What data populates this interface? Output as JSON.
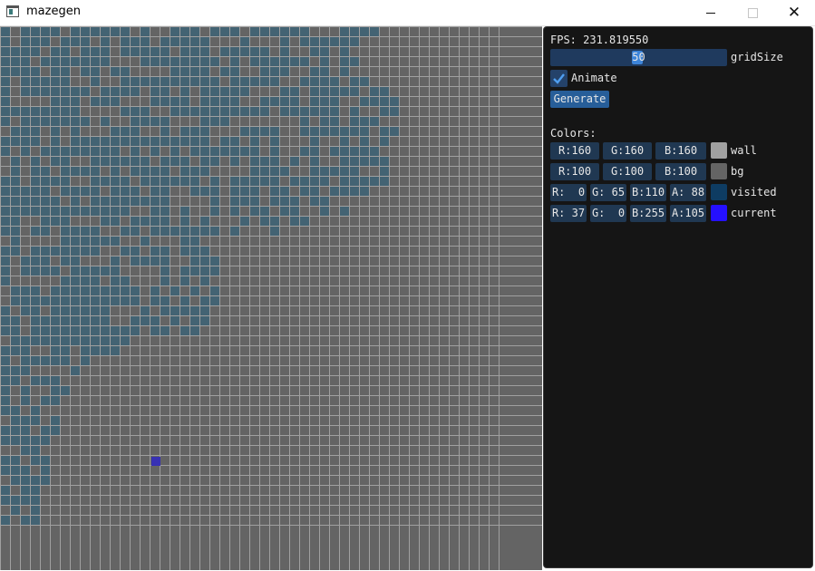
{
  "window": {
    "title": "mazegen",
    "minimize_icon": "window-minimize-icon",
    "maximize_icon": "window-maximize-icon",
    "close_glyph": "✕"
  },
  "maze": {
    "grid_size": 50,
    "colors": {
      "wall": "#a0a0a0",
      "bg": "#646464",
      "visited": "#436373",
      "current": "#3731b4"
    }
  },
  "panel": {
    "fps": "FPS: 231.819550",
    "grid_size_label": "gridSize",
    "grid_size_value": "50",
    "animate_label": "Animate",
    "animate_checked": true,
    "generate_label": "Generate",
    "colors_label": "Colors:",
    "color_rows": [
      {
        "fields": [
          "R:160",
          "G:160",
          "B:160"
        ],
        "label": "wall",
        "swatch": "#a0a0a0"
      },
      {
        "fields": [
          "R:100",
          "G:100",
          "B:100"
        ],
        "label": "bg",
        "swatch": "#646464"
      },
      {
        "fields": [
          "R:  0",
          "G: 65",
          "B:110",
          "A: 88"
        ],
        "label": "visited",
        "swatch": "#0e3c62"
      },
      {
        "fields": [
          "R: 37",
          "G:  0",
          "B:255",
          "A:105"
        ],
        "label": "current",
        "swatch": "#2510ff"
      }
    ]
  }
}
